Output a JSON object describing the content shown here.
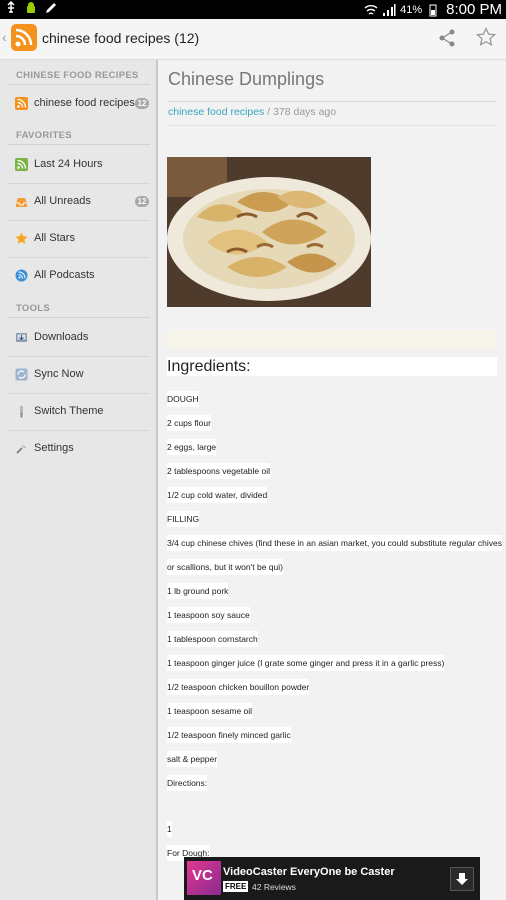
{
  "status_bar": {
    "battery": "41%",
    "time": "8:00 PM"
  },
  "action_bar": {
    "title": "chinese food recipes (12)",
    "icons": [
      "rss-logo-icon",
      "share-icon",
      "star-icon"
    ]
  },
  "sidebar": {
    "sections": [
      {
        "header": "CHINESE FOOD RECIPES",
        "items": [
          {
            "label": "chinese food recipes",
            "badge": "12",
            "icon": "rss-icon"
          }
        ]
      },
      {
        "header": "FAVORITES",
        "items": [
          {
            "label": "Last 24 Hours",
            "badge": "",
            "icon": "rss-green-icon"
          },
          {
            "label": "All Unreads",
            "badge": "12",
            "icon": "inbox-icon"
          },
          {
            "label": "All Stars",
            "badge": "",
            "icon": "star-icon"
          },
          {
            "label": "All Podcasts",
            "badge": "",
            "icon": "podcast-icon"
          }
        ]
      },
      {
        "header": "TOOLS",
        "items": [
          {
            "label": "Downloads",
            "badge": "",
            "icon": "download-icon"
          },
          {
            "label": "Sync Now",
            "badge": "",
            "icon": "sync-icon"
          },
          {
            "label": "Switch Theme",
            "badge": "",
            "icon": "theme-icon"
          },
          {
            "label": "Settings",
            "badge": "",
            "icon": "settings-icon"
          }
        ]
      }
    ]
  },
  "article": {
    "title": "Chinese Dumplings",
    "source": "chinese food recipes",
    "age": " / 378 days ago",
    "heading": "Ingredients:",
    "lines": [
      "DOUGH",
      "2 cups flour",
      "2 eggs, large",
      "2 tablespoons vegetable oil",
      "1/2 cup cold water, divided",
      "FILLING",
      "3/4 cup chinese chives (find these in an asian market, you could substitute regular chives",
      "or scallions, but it won't be qui)",
      "1 lb ground pork",
      "1 teaspoon soy sauce",
      "1 tablespoon cornstarch",
      "1 teaspoon ginger juice (I grate some ginger and press it in a garlic press)",
      "1/2 teaspoon chicken bouillon powder",
      "1 teaspoon sesame oil",
      "1/2 teaspoon finely minced garlic",
      "salt & pepper",
      "Directions:",
      "",
      "1",
      "For Dough:"
    ]
  },
  "ad": {
    "logo_text": "VC",
    "title": "VideoCaster EveryOne be Caster",
    "free": "FREE",
    "reviews": "42 Reviews"
  }
}
